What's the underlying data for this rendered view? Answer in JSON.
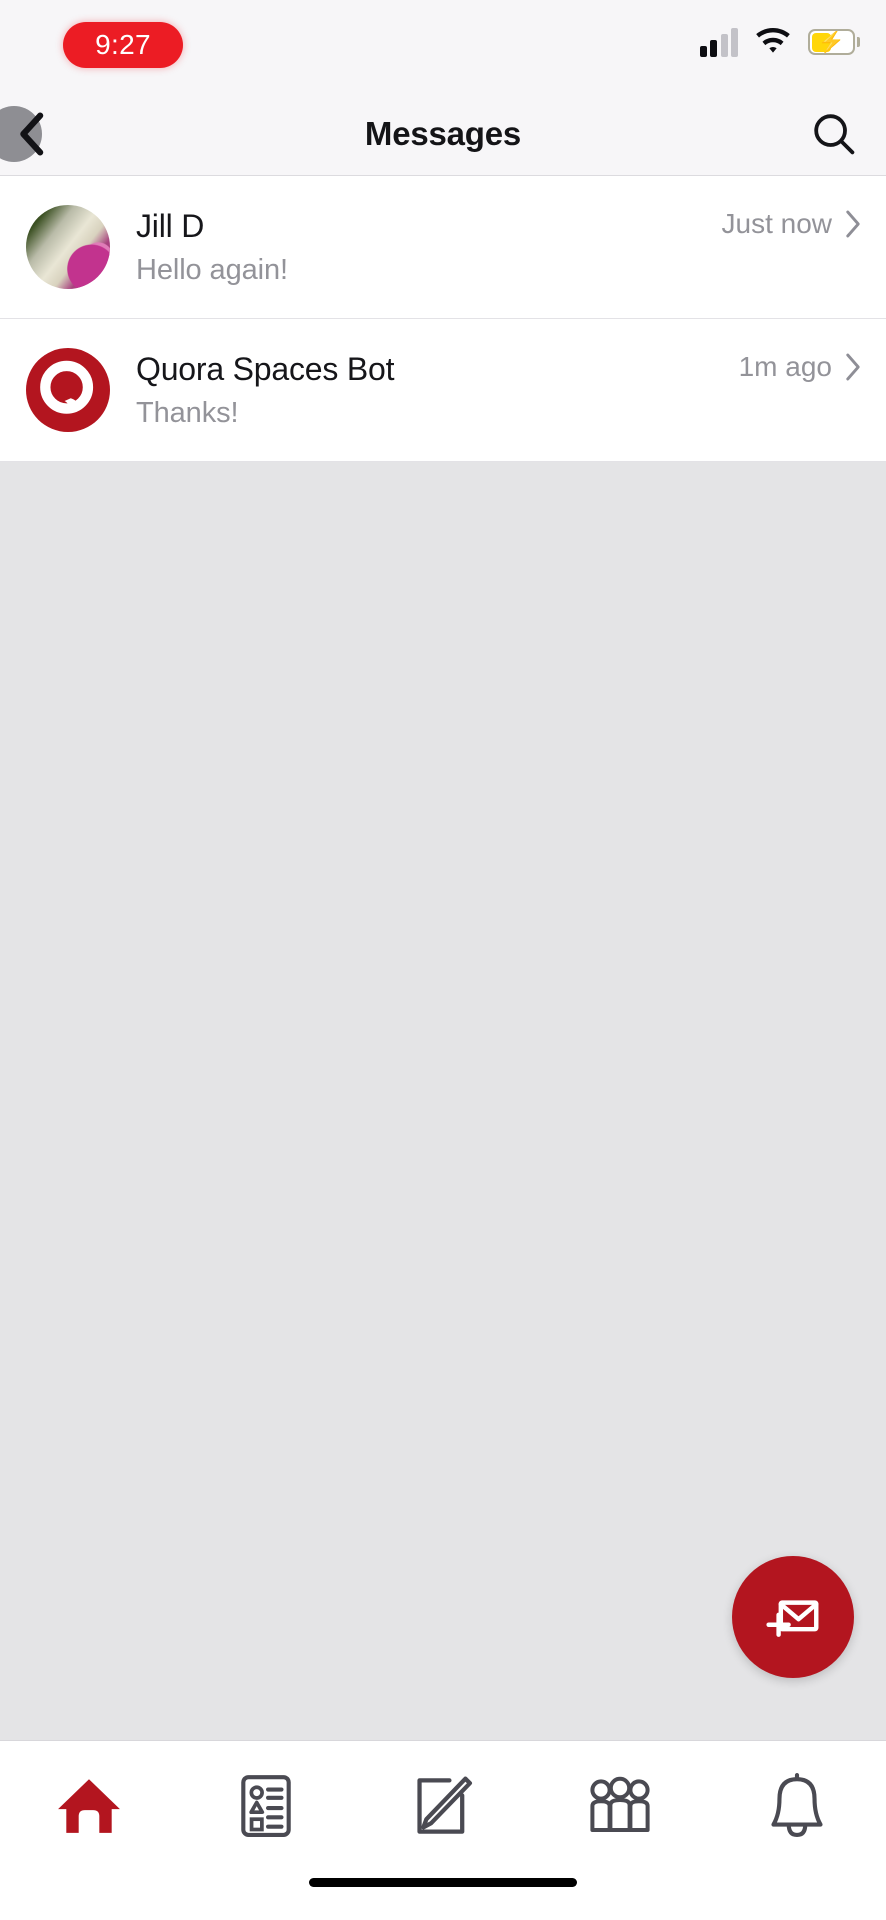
{
  "status_bar": {
    "time": "9:27",
    "time_pill_color": "#ec1c24",
    "signal_icon": "cellular-signal-icon",
    "wifi_icon": "wifi-icon",
    "battery_icon": "battery-charging-low-power-icon",
    "battery_color": "#ffd60a"
  },
  "header": {
    "back_icon": "back-chevron-icon",
    "title": "Messages",
    "search_icon": "search-icon"
  },
  "messages": {
    "rows": [
      {
        "name": "Jill D",
        "preview": "Hello again!",
        "time": "Just now",
        "avatar_type": "photo",
        "chevron": "chevron-right-icon"
      },
      {
        "name": "Quora Spaces Bot",
        "preview": "Thanks!",
        "time": "1m ago",
        "avatar_type": "quora-logo",
        "chevron": "chevron-right-icon"
      }
    ]
  },
  "fab": {
    "icon": "new-message-envelope-plus-icon",
    "color": "#b3151f"
  },
  "tab_bar": {
    "items": [
      {
        "icon": "home-icon",
        "active": true
      },
      {
        "icon": "answers-list-icon",
        "active": false
      },
      {
        "icon": "compose-write-icon",
        "active": false
      },
      {
        "icon": "spaces-people-icon",
        "active": false
      },
      {
        "icon": "notifications-bell-icon",
        "active": false
      }
    ],
    "active_color": "#b3151f",
    "inactive_color": "#4a4a52"
  },
  "system": {
    "home_indicator": "home-indicator"
  }
}
